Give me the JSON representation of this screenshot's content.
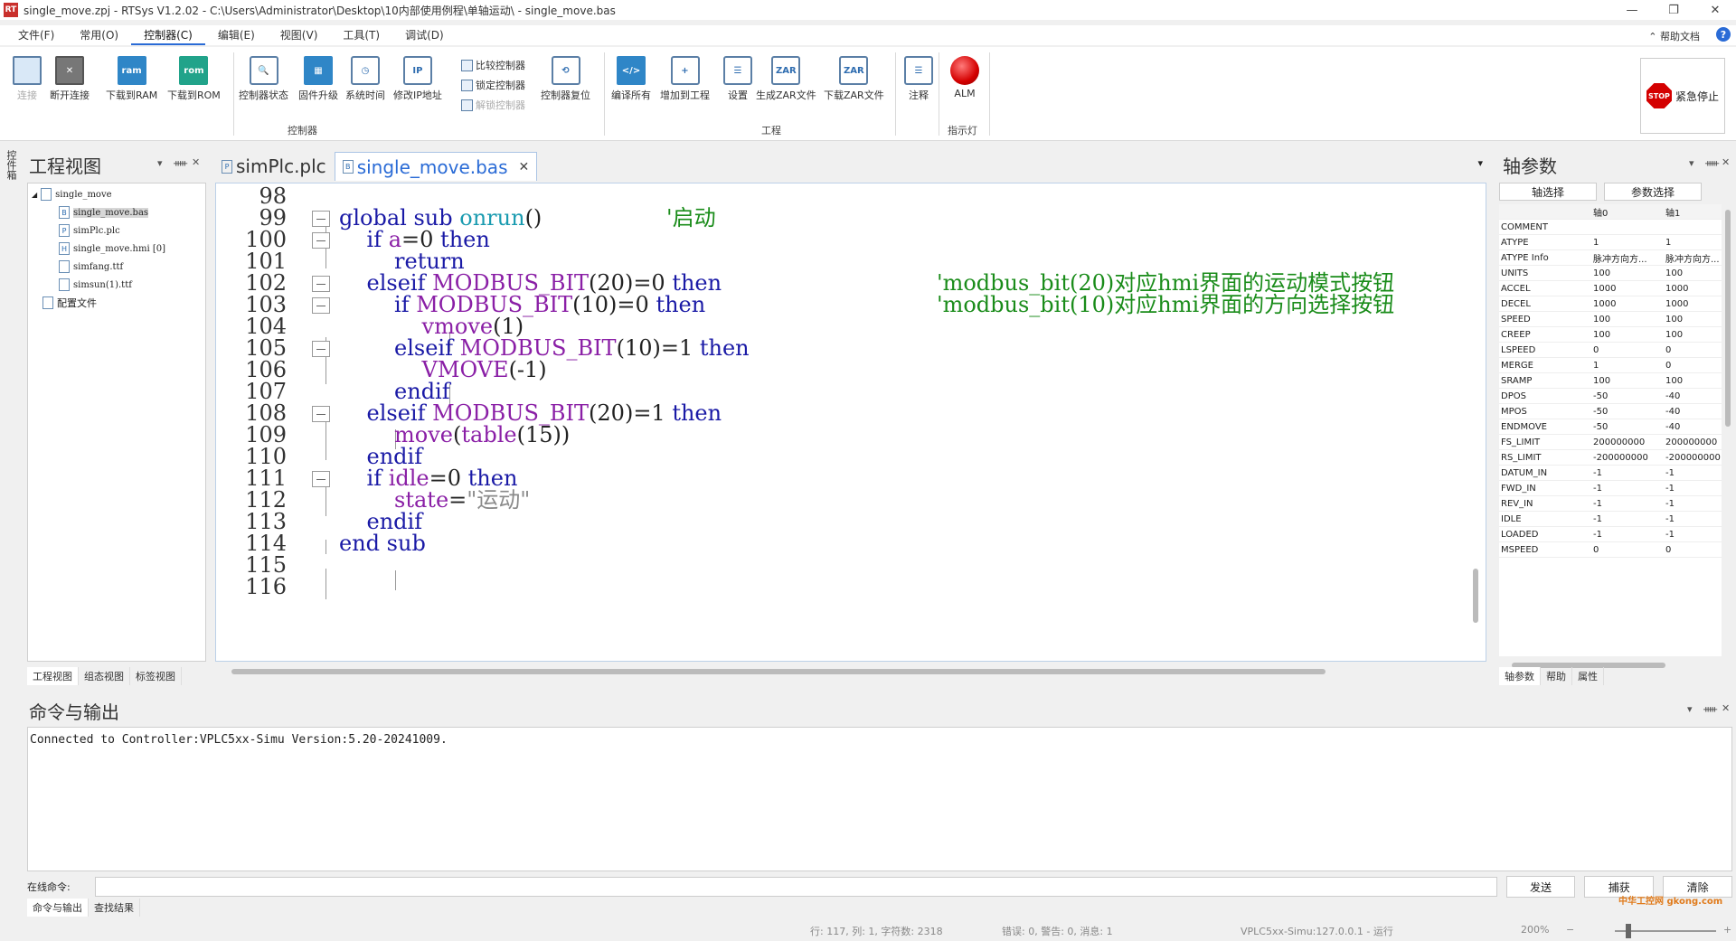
{
  "window": {
    "title": "single_move.zpj - RTSys V1.2.02 - C:\\Users\\Administrator\\Desktop\\10内部使用例程\\单轴运动\\ - single_move.bas",
    "app_icon": "RT"
  },
  "menu": [
    "文件(F)",
    "常用(O)",
    "控制器(C)",
    "编辑(E)",
    "视图(V)",
    "工具(T)",
    "调试(D)"
  ],
  "help": {
    "doc": "帮助文档",
    "icon": "?"
  },
  "ribbon": {
    "buttons": [
      "连接",
      "断开连接",
      "下载到RAM",
      "下载到ROM",
      "控制器状态",
      "固件升级",
      "系统时间",
      "修改IP地址",
      "控制器复位",
      "编译所有",
      "增加到工程",
      "设置",
      "生成ZAR文件",
      "下载ZAR文件",
      "注释",
      "ALM"
    ],
    "small": [
      "比较控制器",
      "锁定控制器",
      "解锁控制器"
    ],
    "icon_text": {
      "ram": "ram",
      "rom": "rom",
      "zar1": "ZAR",
      "zar2": "ZAR"
    },
    "groups": [
      "控制器",
      "工程",
      "指示灯"
    ],
    "estop": "紧急停止",
    "estop_sign": "STOP"
  },
  "side_tab": "控件箱",
  "project": {
    "title": "工程视图",
    "tree": [
      "single_move",
      "single_move.bas",
      "simPlc.plc",
      "single_move.hmi [0]",
      "simfang.ttf",
      "simsun(1).ttf",
      "配置文件"
    ],
    "tree_icons": [
      "B",
      "P",
      "H"
    ],
    "tabs": [
      "工程视图",
      "组态视图",
      "标签视图"
    ]
  },
  "editor": {
    "tabs": [
      "simPlc.plc",
      "single_move.bas"
    ],
    "tab_icons": [
      "P",
      "B"
    ],
    "lines": [
      {
        "n": "98",
        "code": ""
      },
      {
        "n": "99",
        "code": "global sub onrun()",
        "comment": "'启动"
      },
      {
        "n": "100",
        "code": "    if a=0 then"
      },
      {
        "n": "101",
        "code": "        return"
      },
      {
        "n": "102",
        "code": "    elseif MODBUS_BIT(20)=0 then",
        "comment": "'modbus_bit(20)对应hmi界面的运动模式按钮"
      },
      {
        "n": "103",
        "code": "        if MODBUS_BIT(10)=0 then",
        "comment": "'modbus_bit(10)对应hmi界面的方向选择按钮"
      },
      {
        "n": "104",
        "code": "            vmove(1)"
      },
      {
        "n": "105",
        "code": "        elseif MODBUS_BIT(10)=1 then"
      },
      {
        "n": "106",
        "code": "            VMOVE(-1)"
      },
      {
        "n": "107",
        "code": "        endif"
      },
      {
        "n": "108",
        "code": "    elseif MODBUS_BIT(20)=1 then"
      },
      {
        "n": "109",
        "code": "        move(table(15))"
      },
      {
        "n": "110",
        "code": "    endif"
      },
      {
        "n": "111",
        "code": "    if idle=0 then"
      },
      {
        "n": "112",
        "code": "        state=\"运动\""
      },
      {
        "n": "113",
        "code": "    endif"
      },
      {
        "n": "114",
        "code": "end sub"
      },
      {
        "n": "115",
        "code": ""
      },
      {
        "n": "116",
        "code": ""
      }
    ]
  },
  "axis": {
    "title": "轴参数",
    "buttons": [
      "轴选择",
      "参数选择"
    ],
    "headers": [
      "",
      "轴0",
      "轴1"
    ],
    "rows": [
      [
        "COMMENT",
        "",
        ""
      ],
      [
        "ATYPE",
        "1",
        "1"
      ],
      [
        "ATYPE Info",
        "脉冲方向方...",
        "脉冲方向方..."
      ],
      [
        "UNITS",
        "100",
        "100"
      ],
      [
        "ACCEL",
        "1000",
        "1000"
      ],
      [
        "DECEL",
        "1000",
        "1000"
      ],
      [
        "SPEED",
        "100",
        "100"
      ],
      [
        "CREEP",
        "100",
        "100"
      ],
      [
        "LSPEED",
        "0",
        "0"
      ],
      [
        "MERGE",
        "1",
        "0"
      ],
      [
        "SRAMP",
        "100",
        "100"
      ],
      [
        "DPOS",
        "-50",
        "-40"
      ],
      [
        "MPOS",
        "-50",
        "-40"
      ],
      [
        "ENDMOVE",
        "-50",
        "-40"
      ],
      [
        "FS_LIMIT",
        "200000000",
        "200000000"
      ],
      [
        "RS_LIMIT",
        "-200000000",
        "-200000000"
      ],
      [
        "DATUM_IN",
        "-1",
        "-1"
      ],
      [
        "FWD_IN",
        "-1",
        "-1"
      ],
      [
        "REV_IN",
        "-1",
        "-1"
      ],
      [
        "IDLE",
        "-1",
        "-1"
      ],
      [
        "LOADED",
        "-1",
        "-1"
      ],
      [
        "MSPEED",
        "0",
        "0"
      ]
    ],
    "tabs": [
      "轴参数",
      "帮助",
      "属性"
    ]
  },
  "command": {
    "title": "命令与输出",
    "output": "Connected to Controller:VPLC5xx-Simu Version:5.20-20241009.",
    "label": "在线命令:",
    "input_value": "",
    "buttons": [
      "发送",
      "捕获",
      "清除"
    ],
    "tabs": [
      "命令与输出",
      "查找结果"
    ]
  },
  "status": {
    "cursor": "行: 117, 列: 1, 字符数: 2318",
    "errors": "错误: 0, 警告: 0, 消息: 1",
    "controller": "VPLC5xx-Simu:127.0.0.1 - 运行",
    "zoom": "200%",
    "zoom_level": 0.2
  },
  "watermark": "中华工控网 gkong.com"
}
